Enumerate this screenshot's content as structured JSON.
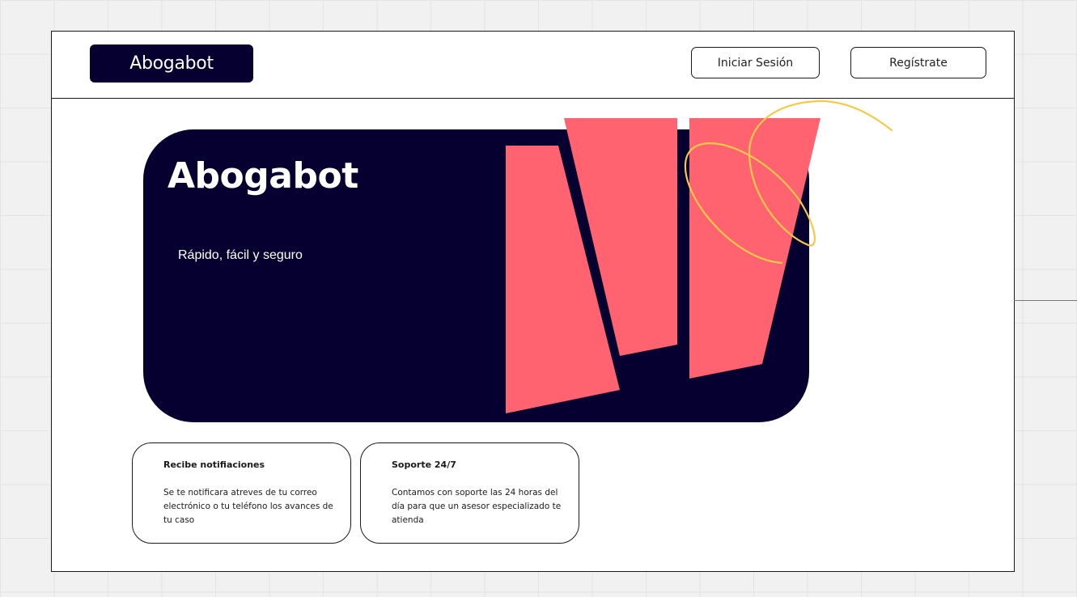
{
  "header": {
    "logo_text": "Abogabot",
    "login_label": "Iniciar Sesión",
    "register_label": "Regístrate"
  },
  "hero": {
    "title": "Abogabot",
    "subtitle": "Rápido, fácil y seguro"
  },
  "features": [
    {
      "title": "Recibe notifiaciones",
      "body": "Se te notificara atreves de tu correo electrónico o tu teléfono los avances de tu caso"
    },
    {
      "title": "Soporte 24/7",
      "body": "Contamos con soporte las 24 horas del día para que un asesor especializado te atienda"
    }
  ],
  "colors": {
    "brand_navy": "#05002f",
    "accent_coral": "#ff6370",
    "accent_yellow": "#f7c948",
    "background": "#f1f1f1"
  }
}
